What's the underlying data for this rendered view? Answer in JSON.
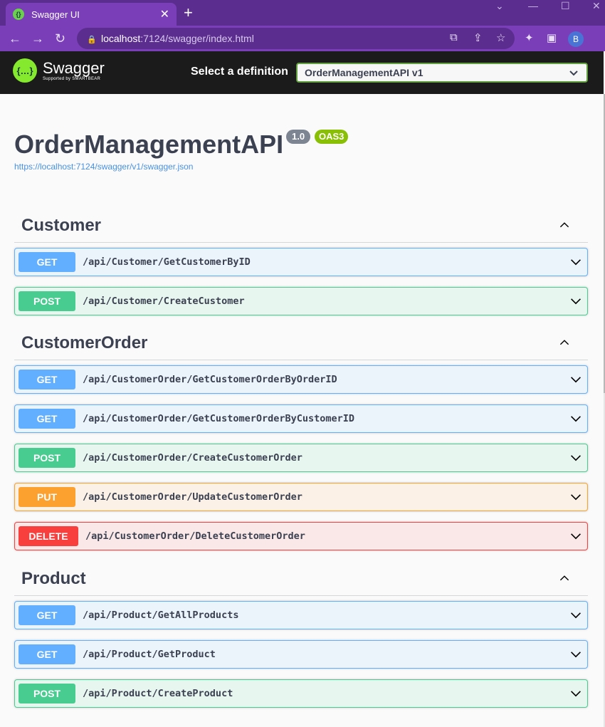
{
  "browser": {
    "tab_title": "Swagger UI",
    "url_host": "localhost",
    "url_path": ":7124/swagger/index.html",
    "profile_initial": "B"
  },
  "topbar": {
    "logo_text": "Swagger",
    "logo_sub": "Supported by SMARTBEAR",
    "definition_label": "Select a definition",
    "definition_selected": "OrderManagementAPI v1"
  },
  "info": {
    "title": "OrderManagementAPI",
    "version": "1.0",
    "oas": "OAS3",
    "url": "https://localhost:7124/swagger/v1/swagger.json"
  },
  "sections": [
    {
      "name": "Customer",
      "operations": [
        {
          "method": "GET",
          "path": "/api/Customer/GetCustomerByID"
        },
        {
          "method": "POST",
          "path": "/api/Customer/CreateCustomer"
        }
      ]
    },
    {
      "name": "CustomerOrder",
      "operations": [
        {
          "method": "GET",
          "path": "/api/CustomerOrder/GetCustomerOrderByOrderID"
        },
        {
          "method": "GET",
          "path": "/api/CustomerOrder/GetCustomerOrderByCustomerID"
        },
        {
          "method": "POST",
          "path": "/api/CustomerOrder/CreateCustomerOrder"
        },
        {
          "method": "PUT",
          "path": "/api/CustomerOrder/UpdateCustomerOrder"
        },
        {
          "method": "DELETE",
          "path": "/api/CustomerOrder/DeleteCustomerOrder"
        }
      ]
    },
    {
      "name": "Product",
      "operations": [
        {
          "method": "GET",
          "path": "/api/Product/GetAllProducts"
        },
        {
          "method": "GET",
          "path": "/api/Product/GetProduct"
        },
        {
          "method": "POST",
          "path": "/api/Product/CreateProduct"
        }
      ]
    }
  ],
  "colors": {
    "get": "#61affe",
    "post": "#49cc90",
    "put": "#fca130",
    "delete": "#f93e3e"
  }
}
